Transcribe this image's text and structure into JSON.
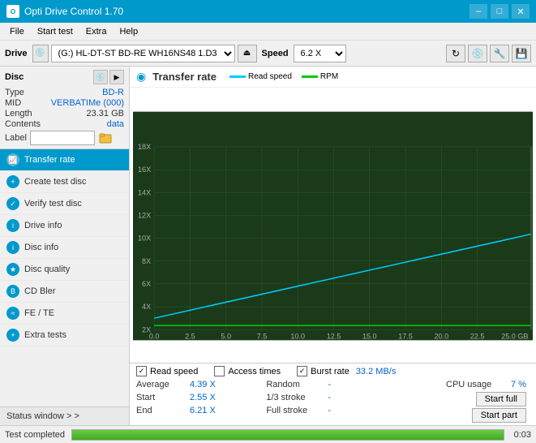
{
  "app": {
    "title": "Opti Drive Control 1.70",
    "icon": "O"
  },
  "titlebar": {
    "minimize": "–",
    "maximize": "□",
    "close": "✕"
  },
  "menu": {
    "items": [
      "File",
      "Start test",
      "Extra",
      "Help"
    ]
  },
  "drivebar": {
    "label": "Drive",
    "drive_value": "(G:)  HL-DT-ST BD-RE  WH16NS48 1.D3",
    "speed_label": "Speed",
    "speed_value": "6.2 X",
    "eject_icon": "⏏"
  },
  "disc": {
    "title": "Disc",
    "type_label": "Type",
    "type_value": "BD-R",
    "mid_label": "MID",
    "mid_value": "VERBATIMe (000)",
    "length_label": "Length",
    "length_value": "23.31 GB",
    "contents_label": "Contents",
    "contents_value": "data",
    "label_label": "Label",
    "label_placeholder": ""
  },
  "nav": {
    "items": [
      {
        "id": "transfer-rate",
        "label": "Transfer rate",
        "active": true
      },
      {
        "id": "create-test-disc",
        "label": "Create test disc",
        "active": false
      },
      {
        "id": "verify-test-disc",
        "label": "Verify test disc",
        "active": false
      },
      {
        "id": "drive-info",
        "label": "Drive info",
        "active": false
      },
      {
        "id": "disc-info",
        "label": "Disc info",
        "active": false
      },
      {
        "id": "disc-quality",
        "label": "Disc quality",
        "active": false
      },
      {
        "id": "cd-bler",
        "label": "CD Bler",
        "active": false
      },
      {
        "id": "fe-te",
        "label": "FE / TE",
        "active": false
      },
      {
        "id": "extra-tests",
        "label": "Extra tests",
        "active": false
      }
    ],
    "status_window": "Status window > >"
  },
  "chart": {
    "title": "Transfer rate",
    "title_icon": "◉",
    "legend": [
      {
        "label": "Read speed",
        "color": "#00ccff"
      },
      {
        "label": "RPM",
        "color": "#00cc00"
      }
    ],
    "x_axis": {
      "label": "GB",
      "ticks": [
        "0.0",
        "2.5",
        "5.0",
        "7.5",
        "10.0",
        "12.5",
        "15.0",
        "17.5",
        "20.0",
        "22.5",
        "25.0 GB"
      ]
    },
    "y_axis": {
      "ticks": [
        "2X",
        "4X",
        "6X",
        "8X",
        "10X",
        "12X",
        "14X",
        "16X",
        "18X"
      ]
    },
    "grid_color": "#2a5a2a",
    "bg_color": "#1a3a1a"
  },
  "stats": {
    "checkboxes": [
      {
        "label": "Read speed",
        "checked": true
      },
      {
        "label": "Access times",
        "checked": false
      },
      {
        "label": "Burst rate",
        "checked": true
      }
    ],
    "burst_rate_value": "33.2 MB/s",
    "rows": [
      {
        "col1_label": "Average",
        "col1_value": "4.39 X",
        "col2_label": "Random",
        "col2_value": "-",
        "col3_label": "CPU usage",
        "col3_value": "7 %",
        "col3_btn": null
      },
      {
        "col1_label": "Start",
        "col1_value": "2.55 X",
        "col2_label": "1/3 stroke",
        "col2_value": "-",
        "col3_btn": "Start full"
      },
      {
        "col1_label": "End",
        "col1_value": "6.21 X",
        "col2_label": "Full stroke",
        "col2_value": "-",
        "col3_btn": "Start part"
      }
    ]
  },
  "statusbar": {
    "text": "Test completed",
    "progress": 100,
    "time": "0:03"
  },
  "colors": {
    "accent": "#0099cc",
    "active_nav": "#0099cc",
    "value_blue": "#0066cc",
    "chart_bg": "#1a3a1a",
    "read_speed_line": "#00ccff",
    "rpm_line": "#00cc00",
    "progress_green": "#44aa22"
  }
}
